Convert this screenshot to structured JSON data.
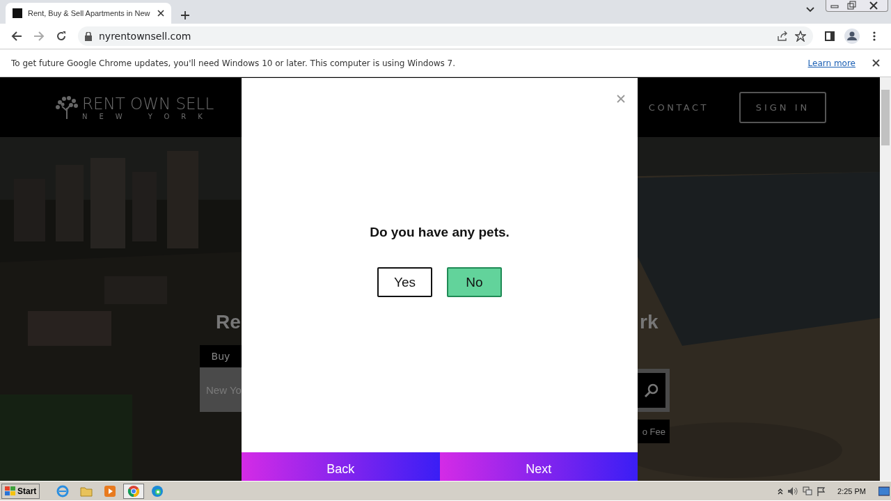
{
  "browser": {
    "tab": {
      "title": "Rent, Buy & Sell Apartments in New"
    },
    "address": "nyrentownsell.com",
    "infobar": {
      "message": "To get future Google Chrome updates, you'll need Windows 10 or later. This computer is using Windows 7.",
      "link": "Learn more"
    }
  },
  "site": {
    "logo": {
      "name": "RENT OWN SELL",
      "sub": "NEW YORK"
    },
    "nav": [
      {
        "label": "CONTACT"
      }
    ],
    "sign_in": "SIGN IN",
    "hero": {
      "heading_left": "Re",
      "heading_right": "rk",
      "tab": "Buy",
      "search_placeholder": "New Yo",
      "filter": "o Fee"
    }
  },
  "modal": {
    "question": "Do you have any pets.",
    "options": [
      {
        "label": "Yes",
        "selected": false
      },
      {
        "label": "No",
        "selected": true
      }
    ],
    "back": "Back",
    "next": "Next"
  },
  "taskbar": {
    "start": "Start",
    "apps": [
      {
        "kind": "ie",
        "selected": false
      },
      {
        "kind": "folder",
        "selected": false
      },
      {
        "kind": "media",
        "selected": false
      },
      {
        "kind": "chrome",
        "selected": true
      },
      {
        "kind": "edge",
        "selected": false
      }
    ],
    "time": "2:25 PM"
  }
}
